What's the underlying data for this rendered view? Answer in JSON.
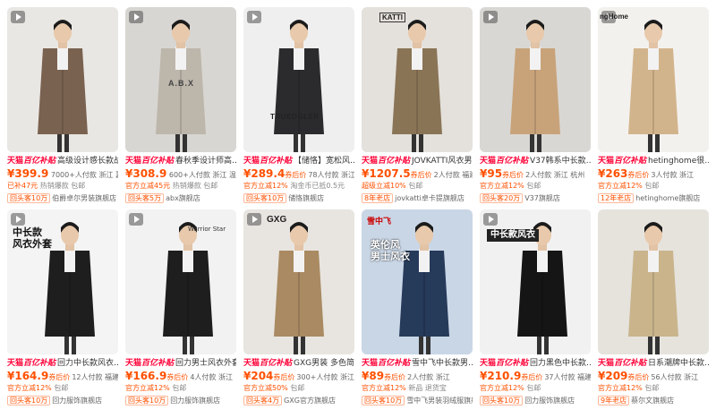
{
  "products": [
    {
      "title": "高级设计感长款战…",
      "price": "¥399.9",
      "after": "",
      "sales": "7000+人付款",
      "location": "浙江 嘉兴",
      "tag1": "已补47元",
      "tag2": "热销爆款",
      "tag3": "包邮",
      "badge": "回头客10万",
      "shop": "伯爵卓尔男装旗舰店",
      "overlay": "",
      "brand_text": "",
      "video": true,
      "coat": "#7a6250",
      "bg": "#e9e7e3"
    },
    {
      "title": "春秋季设计师高…",
      "price": "¥308.9",
      "after": "",
      "sales": "600+人付款",
      "location": "浙江 温州",
      "tag1": "官方立减45元",
      "tag2": "热销爆款",
      "tag3": "包邮",
      "badge": "回头客5万",
      "shop": "abx旗舰店",
      "overlay": "",
      "brand_text": "A.B.X",
      "video": true,
      "coat": "#bdb6ab",
      "bg": "#d8d6d2"
    },
    {
      "title": "【储恪】宽松风…",
      "price": "¥289.4",
      "after": "券后价",
      "sales": "78人付款",
      "location": "浙江",
      "tag1": "官方立减12%",
      "tag2": "淘金币已抵0.5元",
      "tag3": "",
      "badge": "回头客10万",
      "shop": "储恪旗舰店",
      "overlay": "",
      "brand_text": "TRUEOGLER",
      "video": true,
      "coat": "#2b2b2e",
      "bg": "#efefef"
    },
    {
      "title": "JOVKATTI风衣男2026春秋…",
      "price": "¥1207.5",
      "after": "券后价",
      "sales": "2人付款",
      "location": "福建",
      "tag1": "超级立减10%",
      "tag2": "包邮",
      "tag3": "",
      "badge": "8年老店",
      "shop": "jovkatti卓卡提旗舰店",
      "overlay": "",
      "brand_text": "KATTI",
      "video": false,
      "coat": "#8a7456",
      "bg": "#e4e1dc"
    },
    {
      "title": "V37韩系中长款…",
      "price": "¥95",
      "after": "券后价",
      "sales": "2人付款",
      "location": "浙江 杭州",
      "tag1": "官方立减12%",
      "tag2": "包邮",
      "tag3": "",
      "badge": "回头客20万",
      "shop": "V37旗舰店",
      "overlay": "",
      "brand_text": "",
      "video": true,
      "coat": "#c8a37a",
      "bg": "#d9d7d3"
    },
    {
      "title": "hetinghome很…",
      "price": "¥263",
      "after": "券后价",
      "sales": "3人付款",
      "location": "浙江",
      "tag1": "官方立减12%",
      "tag2": "包邮",
      "tag3": "",
      "badge": "12年老店",
      "shop": "hetinghome旗舰店",
      "overlay": "",
      "brand_text": "ngHome",
      "video": true,
      "coat": "#d2b48c",
      "bg": "#f3f1ee"
    },
    {
      "title": "回力中长款风衣…",
      "price": "¥164.9",
      "after": "券后价",
      "sales": "12人付款",
      "location": "福建",
      "tag1": "官方立减12%",
      "tag2": "包邮",
      "tag3": "",
      "badge": "回头客10万",
      "shop": "回力服饰旗舰店",
      "overlay": "中长款\n风衣外套",
      "brand_text": "",
      "video": true,
      "coat": "#1e1e1e",
      "bg": "#f4f4f4"
    },
    {
      "title": "回力男士风衣外套春秋季设…",
      "price": "¥166.9",
      "after": "券后价",
      "sales": "4人付款",
      "location": "浙江",
      "tag1": "官方立减12%",
      "tag2": "包邮",
      "tag3": "",
      "badge": "回头客10万",
      "shop": "回力服饰旗舰店",
      "overlay": "Warrior Star",
      "brand_text": "",
      "video": true,
      "coat": "#1e1e1e",
      "bg": "#f2f2f2"
    },
    {
      "title": "GXG男装 多色简…",
      "price": "¥204",
      "after": "券后价",
      "sales": "300+人付款",
      "location": "浙江",
      "tag1": "官方立减50%",
      "tag2": "包邮",
      "tag3": "",
      "badge": "回头客4万",
      "shop": "GXG官方旗舰店",
      "overlay": "",
      "brand_text": "GXG",
      "video": true,
      "coat": "#a98a62",
      "bg": "#e8e5e0"
    },
    {
      "title": "雪中飞中长款男…",
      "price": "¥89",
      "after": "券后价",
      "sales": "2人付款",
      "location": "浙江",
      "tag1": "官方立减12%",
      "tag2": "新品",
      "tag3": "退货宝",
      "badge": "回头客10万",
      "shop": "雪中飞男装羽绒服旗舰店",
      "overlay": "英伦风\n男士风衣",
      "brand_text": "雪中飞",
      "video": false,
      "coat": "#263a5a",
      "bg": "#c9d6e6"
    },
    {
      "title": "回力黑色中长款…",
      "price": "¥210.9",
      "after": "券后价",
      "sales": "37人付款",
      "location": "福建",
      "tag1": "官方立减12%",
      "tag2": "包邮",
      "tag3": "",
      "badge": "回头客10万",
      "shop": "回力服饰旗舰店",
      "overlay": "中长款风衣",
      "brand_text": "",
      "video": true,
      "coat": "#151515",
      "bg": "#f1f1f1"
    },
    {
      "title": "日系潮牌中长款…",
      "price": "¥209",
      "after": "券后价",
      "sales": "56人付款",
      "location": "浙江",
      "tag1": "官方立减12%",
      "tag2": "包邮",
      "tag3": "",
      "badge": "9年老店",
      "shop": "蔡尔文旗舰店",
      "overlay": "",
      "brand_text": "",
      "video": false,
      "coat": "#c9b48c",
      "bg": "#e6e3dd"
    }
  ],
  "tmall_label": "天猫",
  "promo_label": "百亿补贴"
}
